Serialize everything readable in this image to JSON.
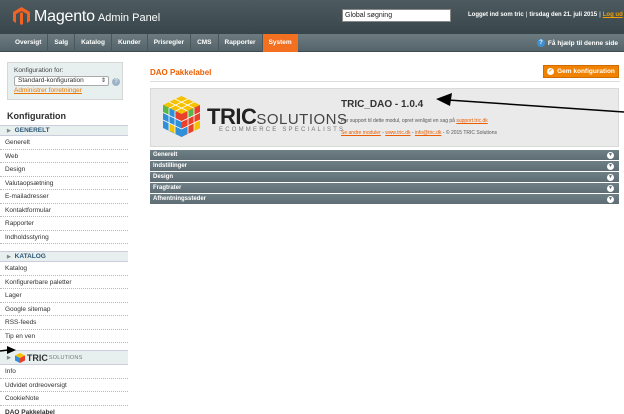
{
  "header": {
    "app_name": "Magento",
    "app_sub": "Admin Panel",
    "search_value": "Global søgning",
    "user_text": "Logget ind som tric",
    "date_text": "tirsdag den 21. juli 2015",
    "logout": "Log ud"
  },
  "nav": {
    "items": [
      "Oversigt",
      "Salg",
      "Katalog",
      "Kunder",
      "Prisregler",
      "CMS",
      "Rapporter",
      "System"
    ],
    "active": "System",
    "help": "Få hjælp til denne side"
  },
  "sidebar": {
    "scope_label": "Konfiguration for:",
    "scope_value": "Standard-konfiguration",
    "scope_manage": "Administrer forretninger",
    "title": "Konfiguration",
    "groups": [
      {
        "label": "GENERELT",
        "items": [
          "Generelt",
          "Web",
          "Design",
          "Valutaopsætning",
          "E-mailadresser",
          "Kontaktformular",
          "Rapporter",
          "Indholdsstyring"
        ]
      },
      {
        "label": "KATALOG",
        "items": [
          "Katalog",
          "Konfigurerbare paletter",
          "Lager",
          "Google sitemap",
          "RSS-feeds",
          "Tip en ven"
        ]
      },
      {
        "label_big": "TRIC",
        "label_small": "SOLUTIONS",
        "items": [
          "Info",
          "Udvidet ordreoversigt",
          "CookieNote",
          "DAO Pakkelabel"
        ]
      }
    ]
  },
  "main": {
    "title": "DAO Pakkelabel",
    "save_label": "Gem konfiguration",
    "brand_big": "TRIC",
    "brand_small": "SOLUTIONS",
    "brand_tag": "ECOMMERCE SPECIALISTS",
    "module_name": "TRIC_DAO - 1.0.4",
    "support_text": "For support til dette modul, opret venligst en sag på",
    "support_link": "support.tric.dk",
    "link_1": "Se andre moduler",
    "link_2": "www.tric.dk",
    "link_3": "info@tric.dk",
    "copyright": "© 2015 TRIC Solutions",
    "sections": [
      "Generelt",
      "Indstillinger",
      "Design",
      "Fragtrater",
      "Afhentningssteder"
    ]
  },
  "colors": {
    "accent": "#f27020",
    "title_orange": "#eb5e00",
    "section_bar": "#65747a",
    "header_bg": "#435156"
  },
  "icons": [
    "magento-logo-icon",
    "help-icon",
    "chevron-down-icon",
    "tric-cube-icon",
    "save-icon"
  ]
}
